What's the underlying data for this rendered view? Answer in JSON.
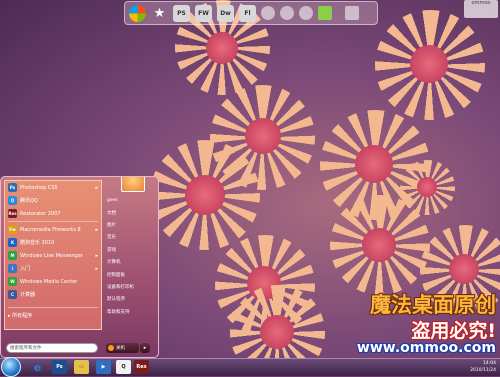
{
  "dock": {
    "icons": [
      {
        "name": "windows-icon",
        "label": ""
      },
      {
        "name": "star-icon",
        "label": "★"
      },
      {
        "name": "photoshop-icon",
        "label": "PS"
      },
      {
        "name": "fireworks-icon",
        "label": "FW"
      },
      {
        "name": "dreamweaver-icon",
        "label": "Dw"
      },
      {
        "name": "flash-icon",
        "label": "Fl"
      }
    ]
  },
  "start_menu": {
    "programs": [
      {
        "label": "Photoshop CS5",
        "color": "#2d6fb5",
        "icon": "Ps",
        "arrow": "▸"
      },
      {
        "label": "腾讯QQ",
        "color": "#2a8be0",
        "icon": "Q",
        "arrow": ""
      },
      {
        "label": "Restorator 2007",
        "color": "#7a1c1c",
        "icon": "Res",
        "arrow": ""
      },
      {
        "label": "Macromedia Fireworks 8",
        "color": "#d8a017",
        "icon": "Fw",
        "arrow": "▸"
      },
      {
        "label": "酷狗音乐 2010",
        "color": "#1767c8",
        "icon": "K",
        "arrow": ""
      },
      {
        "label": "Windows Live Messenger",
        "color": "#2aa248",
        "icon": "M",
        "arrow": "▸"
      },
      {
        "label": "入门",
        "color": "#3976c9",
        "icon": "i",
        "arrow": "▸"
      },
      {
        "label": "Windows Media Center",
        "color": "#32a43a",
        "icon": "W",
        "arrow": ""
      },
      {
        "label": "计算器",
        "color": "#3d5a9c",
        "icon": "C",
        "arrow": ""
      }
    ],
    "all_programs": "▸ 所有程序",
    "right_links": [
      "gees",
      "文档",
      "图片",
      "音乐",
      "游戏",
      "计算机",
      "控制面板",
      "设备和打印机",
      "默认程序",
      "帮助和支持"
    ],
    "search_placeholder": "搜索程序和文件",
    "shutdown_label": "关机"
  },
  "taskbar": {
    "pinned": [
      {
        "name": "ie-icon",
        "label": "e",
        "color": "#2a7fd0"
      },
      {
        "name": "photoshop-icon",
        "label": "Ps",
        "color": "#1d4e8d"
      },
      {
        "name": "explorer-icon",
        "label": "▭",
        "color": "#e6c04b"
      },
      {
        "name": "media-player-icon",
        "label": "▶",
        "color": "#2e6fbf"
      },
      {
        "name": "qq-icon",
        "label": "Q",
        "color": "#f2f2f2"
      },
      {
        "name": "restorator-icon",
        "label": "Res",
        "color": "#7a1c1c"
      }
    ],
    "time": "14:04",
    "date": "2010/11/24"
  },
  "watermark": {
    "line1": "魔法桌面原创",
    "line2": "盗用必究!",
    "line3": "www.ommoo.com"
  }
}
